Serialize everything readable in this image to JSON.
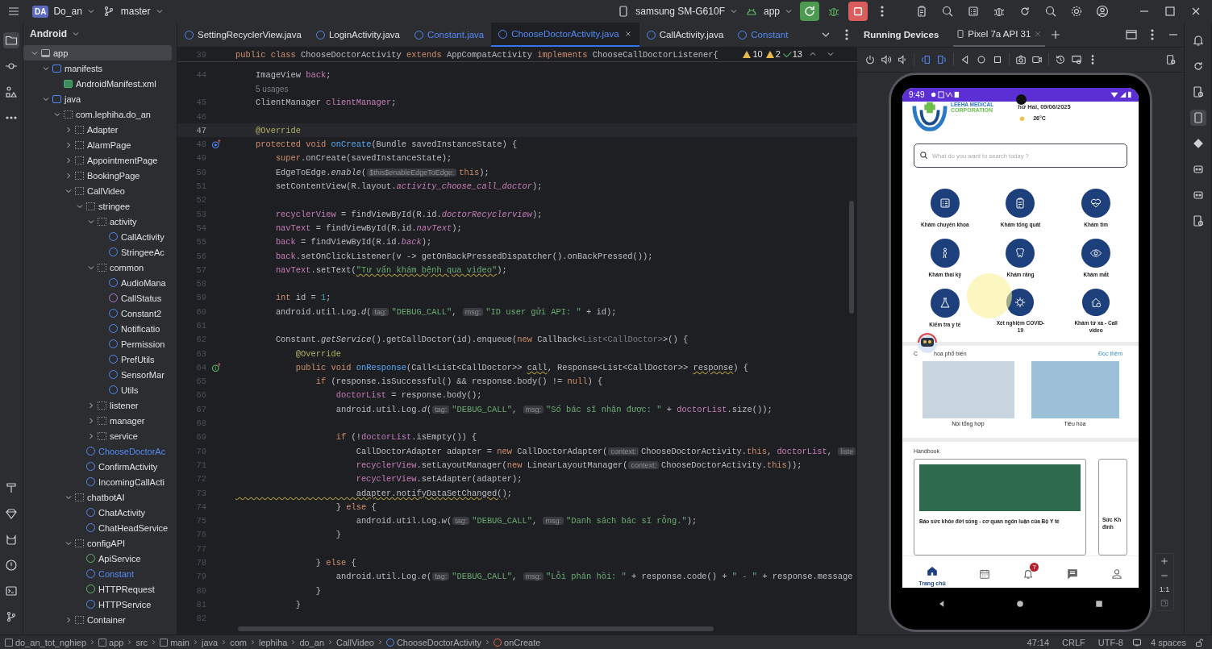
{
  "toolbar": {
    "project_badge": "DA",
    "project": "Do_an",
    "branch": "master",
    "device": "samsung SM-G610F",
    "run_config": "app"
  },
  "project_panel": {
    "view": "Android",
    "tree": [
      {
        "label": "app",
        "kind": "module",
        "expanded": true,
        "selected": true,
        "modified": false,
        "children": [
          {
            "label": "manifests",
            "kind": "folder",
            "expanded": true,
            "selected": false,
            "modified": false,
            "children": [
              {
                "label": "AndroidManifest.xml",
                "kind": "manifest",
                "selected": false,
                "modified": false
              }
            ]
          },
          {
            "label": "java",
            "kind": "folder",
            "expanded": true,
            "selected": false,
            "modified": false,
            "children": [
              {
                "label": "com.lephiha.do_an",
                "kind": "package",
                "expanded": true,
                "selected": false,
                "modified": false,
                "children": [
                  {
                    "label": "Adapter",
                    "kind": "package",
                    "expanded": false,
                    "selected": false,
                    "modified": false
                  },
                  {
                    "label": "AlarmPage",
                    "kind": "package",
                    "expanded": false,
                    "selected": false,
                    "modified": false
                  },
                  {
                    "label": "AppointmentPage",
                    "kind": "package",
                    "expanded": false,
                    "selected": false,
                    "modified": false
                  },
                  {
                    "label": "BookingPage",
                    "kind": "package",
                    "expanded": false,
                    "selected": false,
                    "modified": false
                  },
                  {
                    "label": "CallVideo",
                    "kind": "package",
                    "expanded": true,
                    "selected": false,
                    "modified": false,
                    "children": [
                      {
                        "label": "stringee",
                        "kind": "package",
                        "expanded": true,
                        "selected": false,
                        "modified": false,
                        "children": [
                          {
                            "label": "activity",
                            "kind": "package",
                            "expanded": true,
                            "selected": false,
                            "modified": false,
                            "children": [
                              {
                                "label": "CallActivity",
                                "kind": "class",
                                "selected": false,
                                "modified": false
                              },
                              {
                                "label": "StringeeAc",
                                "kind": "class",
                                "selected": false,
                                "modified": false
                              }
                            ]
                          },
                          {
                            "label": "common",
                            "kind": "package",
                            "expanded": true,
                            "selected": false,
                            "modified": false,
                            "children": [
                              {
                                "label": "AudioMana",
                                "kind": "class",
                                "selected": false,
                                "modified": false
                              },
                              {
                                "label": "CallStatus",
                                "kind": "enum",
                                "selected": false,
                                "modified": false
                              },
                              {
                                "label": "Constant2",
                                "kind": "class",
                                "selected": false,
                                "modified": false
                              },
                              {
                                "label": "Notificatio",
                                "kind": "class",
                                "selected": false,
                                "modified": false
                              },
                              {
                                "label": "Permission",
                                "kind": "class",
                                "selected": false,
                                "modified": false
                              },
                              {
                                "label": "PrefUtils",
                                "kind": "class",
                                "selected": false,
                                "modified": false
                              },
                              {
                                "label": "SensorMar",
                                "kind": "class",
                                "selected": false,
                                "modified": false
                              },
                              {
                                "label": "Utils",
                                "kind": "class",
                                "selected": false,
                                "modified": false
                              }
                            ]
                          },
                          {
                            "label": "listener",
                            "kind": "package",
                            "expanded": false,
                            "selected": false,
                            "modified": false
                          },
                          {
                            "label": "manager",
                            "kind": "package",
                            "expanded": false,
                            "selected": false,
                            "modified": false
                          },
                          {
                            "label": "service",
                            "kind": "package",
                            "expanded": false,
                            "selected": false,
                            "modified": false
                          }
                        ]
                      },
                      {
                        "label": "ChooseDoctorAc",
                        "kind": "class",
                        "selected": false,
                        "modified": true
                      },
                      {
                        "label": "ConfirmActivity",
                        "kind": "class",
                        "selected": false,
                        "modified": false
                      },
                      {
                        "label": "IncomingCallActi",
                        "kind": "class",
                        "selected": false,
                        "modified": false
                      }
                    ]
                  },
                  {
                    "label": "chatbotAI",
                    "kind": "package",
                    "expanded": true,
                    "selected": false,
                    "modified": false,
                    "children": [
                      {
                        "label": "ChatActivity",
                        "kind": "class",
                        "selected": false,
                        "modified": false
                      },
                      {
                        "label": "ChatHeadService",
                        "kind": "class",
                        "selected": false,
                        "modified": false
                      }
                    ]
                  },
                  {
                    "label": "configAPI",
                    "kind": "package",
                    "expanded": true,
                    "selected": false,
                    "modified": false,
                    "children": [
                      {
                        "label": "ApiService",
                        "kind": "interface",
                        "selected": false,
                        "modified": false
                      },
                      {
                        "label": "Constant",
                        "kind": "class",
                        "selected": false,
                        "modified": true
                      },
                      {
                        "label": "HTTPRequest",
                        "kind": "interface",
                        "selected": false,
                        "modified": false
                      },
                      {
                        "label": "HTTPService",
                        "kind": "class",
                        "selected": false,
                        "modified": false
                      }
                    ]
                  },
                  {
                    "label": "Container",
                    "kind": "package",
                    "expanded": false,
                    "selected": false,
                    "modified": false
                  }
                ]
              }
            ]
          }
        ]
      }
    ]
  },
  "editor_tabs": [
    {
      "label": "SettingRecyclerView.java",
      "selected": false,
      "modified": false
    },
    {
      "label": "LoginActivity.java",
      "selected": false,
      "modified": false
    },
    {
      "label": "Constant.java",
      "selected": false,
      "modified": true
    },
    {
      "label": "ChooseDoctorActivity.java",
      "selected": true,
      "modified": true
    },
    {
      "label": "CallActivity.java",
      "selected": false,
      "modified": false
    },
    {
      "label": "Constant",
      "selected": false,
      "modified": true
    }
  ],
  "inspections": {
    "errors": "10",
    "warnings": "2",
    "passed": "13"
  },
  "code": [
    {
      "num": "39",
      "kind": "line",
      "current": false,
      "tokens": [
        {
          "kind": "keyword",
          "text": "public class "
        },
        {
          "kind": "plain",
          "text": "ChooseDoctorActivity "
        },
        {
          "kind": "keyword",
          "text": "extends "
        },
        {
          "kind": "plain",
          "text": "AppCompatActivity "
        },
        {
          "kind": "keyword",
          "text": "implements "
        },
        {
          "kind": "plain",
          "text": "ChooseCallDoctorListener{"
        }
      ]
    },
    {
      "num": "44",
      "kind": "line",
      "current": false,
      "tokens": [
        {
          "kind": "plain",
          "text": "    ImageView "
        },
        {
          "kind": "field",
          "text": "back"
        },
        {
          "kind": "plain",
          "text": ";"
        }
      ]
    },
    {
      "kind": "usages",
      "text": "5 usages"
    },
    {
      "num": "45",
      "kind": "line",
      "current": false,
      "tokens": [
        {
          "kind": "plain",
          "text": "    ClientManager "
        },
        {
          "kind": "field",
          "text": "clientManager"
        },
        {
          "kind": "plain",
          "text": ";"
        }
      ]
    },
    {
      "num": "46",
      "kind": "line",
      "current": false
    },
    {
      "num": "47",
      "kind": "line",
      "current": true,
      "tokens": [
        {
          "kind": "annotation",
          "text": "    @Override"
        }
      ]
    },
    {
      "num": "48",
      "kind": "line",
      "current": false,
      "gutter": {
        "kind": "override"
      },
      "tokens": [
        {
          "kind": "keyword",
          "text": "    protected void "
        },
        {
          "kind": "func",
          "text": "onCreate"
        },
        {
          "kind": "plain",
          "text": "(Bundle savedInstanceState) {"
        }
      ]
    },
    {
      "num": "49",
      "kind": "line",
      "current": false,
      "tokens": [
        {
          "kind": "keyword",
          "text": "        super"
        },
        {
          "kind": "plain",
          "text": ".onCreate(savedInstanceState);"
        }
      ]
    },
    {
      "num": "50",
      "kind": "line",
      "current": false,
      "tokens": [
        {
          "kind": "plain",
          "text": "        EdgeToEdge."
        },
        {
          "kind": "italic",
          "text": "enable"
        },
        {
          "kind": "plain",
          "text": "("
        },
        {
          "kind": "hint",
          "text": "$this$enableEdgeToEdge:"
        },
        {
          "kind": "keyword",
          "text": "this"
        },
        {
          "kind": "plain",
          "text": ");"
        }
      ]
    },
    {
      "num": "51",
      "kind": "line",
      "current": false,
      "tokens": [
        {
          "kind": "plain",
          "text": "        setContentView(R.layout."
        },
        {
          "kind": "static_field",
          "text": "activity_choose_call_doctor"
        },
        {
          "kind": "plain",
          "text": ");"
        }
      ]
    },
    {
      "num": "52",
      "kind": "line",
      "current": false
    },
    {
      "num": "53",
      "kind": "line",
      "current": false,
      "tokens": [
        {
          "kind": "field",
          "text": "        recyclerView"
        },
        {
          "kind": "plain",
          "text": " = findViewById(R.id."
        },
        {
          "kind": "static_field",
          "text": "doctorRecyclerview"
        },
        {
          "kind": "plain",
          "text": ");"
        }
      ]
    },
    {
      "num": "54",
      "kind": "line",
      "current": false,
      "tokens": [
        {
          "kind": "field",
          "text": "        navText"
        },
        {
          "kind": "plain",
          "text": " = findViewById(R.id."
        },
        {
          "kind": "static_field",
          "text": "navText"
        },
        {
          "kind": "plain",
          "text": ");"
        }
      ]
    },
    {
      "num": "55",
      "kind": "line",
      "current": false,
      "tokens": [
        {
          "kind": "field",
          "text": "        back"
        },
        {
          "kind": "plain",
          "text": " = findViewById(R.id."
        },
        {
          "kind": "static_field",
          "text": "back"
        },
        {
          "kind": "plain",
          "text": ");"
        }
      ]
    },
    {
      "num": "56",
      "kind": "line",
      "current": false,
      "tokens": [
        {
          "kind": "field",
          "text": "        back"
        },
        {
          "kind": "plain",
          "text": ".setOnClickListener(v -> getOnBackPressedDispatcher().onBackPressed());"
        }
      ]
    },
    {
      "num": "57",
      "kind": "line",
      "current": false,
      "tokens": [
        {
          "kind": "field",
          "text": "        navText"
        },
        {
          "kind": "plain",
          "text": ".setText("
        },
        {
          "kind": "string_typo",
          "text": "\"Tư vấn khám bệnh qua video\""
        },
        {
          "kind": "plain",
          "text": ");"
        }
      ]
    },
    {
      "num": "58",
      "kind": "line",
      "current": false
    },
    {
      "num": "59",
      "kind": "line",
      "current": false,
      "tokens": [
        {
          "kind": "keyword",
          "text": "        int "
        },
        {
          "kind": "plain",
          "text": "id = "
        },
        {
          "kind": "number",
          "text": "1"
        },
        {
          "kind": "plain",
          "text": ";"
        }
      ]
    },
    {
      "num": "60",
      "kind": "line",
      "current": false,
      "tokens": [
        {
          "kind": "plain",
          "text": "        android.util.Log."
        },
        {
          "kind": "italic",
          "text": "d"
        },
        {
          "kind": "plain",
          "text": "("
        },
        {
          "kind": "hint",
          "text": "tag:"
        },
        {
          "kind": "string",
          "text": "\"DEBUG_CALL\""
        },
        {
          "kind": "plain",
          "text": ", "
        },
        {
          "kind": "hint",
          "text": "msg:"
        },
        {
          "kind": "string",
          "text": "\"ID user gửi API: \""
        },
        {
          "kind": "plain",
          "text": " + id);"
        }
      ]
    },
    {
      "num": "61",
      "kind": "line",
      "current": false
    },
    {
      "num": "62",
      "kind": "line",
      "current": false,
      "tokens": [
        {
          "kind": "plain",
          "text": "        Constant."
        },
        {
          "kind": "italic",
          "text": "getService"
        },
        {
          "kind": "plain",
          "text": "().getCallDoctor(id).enqueue("
        },
        {
          "kind": "keyword",
          "text": "new "
        },
        {
          "kind": "plain",
          "text": "Callback<"
        },
        {
          "kind": "type_arg",
          "text": "List<CallDoctor>"
        },
        {
          "kind": "plain",
          "text": ">() {"
        }
      ]
    },
    {
      "num": "63",
      "kind": "line",
      "current": false,
      "tokens": [
        {
          "kind": "annotation",
          "text": "            @Override"
        }
      ]
    },
    {
      "num": "64",
      "kind": "line",
      "current": false,
      "gutter": {
        "kind": "implement"
      },
      "tokens": [
        {
          "kind": "keyword",
          "text": "            public void "
        },
        {
          "kind": "func",
          "text": "onResponse"
        },
        {
          "kind": "plain",
          "text": "(Call<List<CallDoctor>> "
        },
        {
          "kind": "typo",
          "text": "call"
        },
        {
          "kind": "plain",
          "text": ", Response<List<CallDoctor>> "
        },
        {
          "kind": "typo",
          "text": "response"
        },
        {
          "kind": "plain",
          "text": ") {"
        }
      ]
    },
    {
      "num": "65",
      "kind": "line",
      "current": false,
      "tokens": [
        {
          "kind": "keyword",
          "text": "                if "
        },
        {
          "kind": "plain",
          "text": "(response.isSuccessful() && response.body() != "
        },
        {
          "kind": "keyword",
          "text": "null"
        },
        {
          "kind": "plain",
          "text": ") {"
        }
      ]
    },
    {
      "num": "66",
      "kind": "line",
      "current": false,
      "tokens": [
        {
          "kind": "field",
          "text": "                    doctorList"
        },
        {
          "kind": "plain",
          "text": " = response.body();"
        }
      ]
    },
    {
      "num": "67",
      "kind": "line",
      "current": false,
      "tokens": [
        {
          "kind": "plain",
          "text": "                    android.util.Log."
        },
        {
          "kind": "italic",
          "text": "d"
        },
        {
          "kind": "plain",
          "text": "("
        },
        {
          "kind": "hint",
          "text": "tag:"
        },
        {
          "kind": "string",
          "text": "\"DEBUG_CALL\""
        },
        {
          "kind": "plain",
          "text": ", "
        },
        {
          "kind": "hint",
          "text": "msg:"
        },
        {
          "kind": "string",
          "text": "\"Số bác sĩ nhận được: \""
        },
        {
          "kind": "plain",
          "text": " + "
        },
        {
          "kind": "field",
          "text": "doctorList"
        },
        {
          "kind": "plain",
          "text": ".size());"
        }
      ]
    },
    {
      "num": "68",
      "kind": "line",
      "current": false
    },
    {
      "num": "69",
      "kind": "line",
      "current": false,
      "tokens": [
        {
          "kind": "keyword",
          "text": "                    if "
        },
        {
          "kind": "plain",
          "text": "(!"
        },
        {
          "kind": "field",
          "text": "doctorList"
        },
        {
          "kind": "plain",
          "text": ".isEmpty()) {"
        }
      ]
    },
    {
      "num": "70",
      "kind": "line",
      "current": false,
      "tokens": [
        {
          "kind": "plain",
          "text": "                        CallDoctorAdapter adapter = "
        },
        {
          "kind": "keyword",
          "text": "new "
        },
        {
          "kind": "plain",
          "text": "CallDoctorAdapter("
        },
        {
          "kind": "hint",
          "text": "context:"
        },
        {
          "kind": "plain",
          "text": "ChooseDoctorActivity."
        },
        {
          "kind": "keyword",
          "text": "this"
        },
        {
          "kind": "plain",
          "text": ", "
        },
        {
          "kind": "field",
          "text": "doctorList"
        },
        {
          "kind": "plain",
          "text": ", "
        },
        {
          "kind": "hint",
          "text": "liste"
        }
      ]
    },
    {
      "num": "71",
      "kind": "line",
      "current": false,
      "tokens": [
        {
          "kind": "field",
          "text": "                        recyclerView"
        },
        {
          "kind": "plain",
          "text": ".setLayoutManager("
        },
        {
          "kind": "keyword",
          "text": "new "
        },
        {
          "kind": "plain",
          "text": "LinearLayoutManager("
        },
        {
          "kind": "hint",
          "text": "context:"
        },
        {
          "kind": "plain",
          "text": "ChooseDoctorActivity."
        },
        {
          "kind": "keyword",
          "text": "this"
        },
        {
          "kind": "plain",
          "text": "));"
        }
      ]
    },
    {
      "num": "72",
      "kind": "line",
      "current": false,
      "tokens": [
        {
          "kind": "field",
          "text": "                        recyclerView"
        },
        {
          "kind": "plain",
          "text": ".setAdapter(adapter);"
        }
      ]
    },
    {
      "num": "73",
      "kind": "line",
      "current": false,
      "tokens": [
        {
          "kind": "typo",
          "text": "                        adapter.notifyDataSetChanged()"
        },
        {
          "kind": "plain",
          "text": ";"
        }
      ]
    },
    {
      "num": "74",
      "kind": "line",
      "current": false,
      "tokens": [
        {
          "kind": "plain",
          "text": "                    } "
        },
        {
          "kind": "keyword",
          "text": "else"
        },
        {
          "kind": "plain",
          "text": " {"
        }
      ]
    },
    {
      "num": "75",
      "kind": "line",
      "current": false,
      "tokens": [
        {
          "kind": "plain",
          "text": "                        android.util.Log."
        },
        {
          "kind": "italic",
          "text": "w"
        },
        {
          "kind": "plain",
          "text": "("
        },
        {
          "kind": "hint",
          "text": "tag:"
        },
        {
          "kind": "string",
          "text": "\"DEBUG_CALL\""
        },
        {
          "kind": "plain",
          "text": ", "
        },
        {
          "kind": "hint",
          "text": "msg:"
        },
        {
          "kind": "string",
          "text": "\"Danh sách bác sĩ rỗng.\""
        },
        {
          "kind": "plain",
          "text": ");"
        }
      ]
    },
    {
      "num": "76",
      "kind": "line",
      "current": false,
      "tokens": [
        {
          "kind": "plain",
          "text": "                    }"
        }
      ]
    },
    {
      "num": "77",
      "kind": "line",
      "current": false
    },
    {
      "num": "78",
      "kind": "line",
      "current": false,
      "tokens": [
        {
          "kind": "plain",
          "text": "                } "
        },
        {
          "kind": "keyword",
          "text": "else"
        },
        {
          "kind": "plain",
          "text": " {"
        }
      ]
    },
    {
      "num": "79",
      "kind": "line",
      "current": false,
      "tokens": [
        {
          "kind": "plain",
          "text": "                    android.util.Log."
        },
        {
          "kind": "italic",
          "text": "e"
        },
        {
          "kind": "plain",
          "text": "("
        },
        {
          "kind": "hint",
          "text": "tag:"
        },
        {
          "kind": "string",
          "text": "\"DEBUG_CALL\""
        },
        {
          "kind": "plain",
          "text": ", "
        },
        {
          "kind": "hint",
          "text": "msg:"
        },
        {
          "kind": "string",
          "text": "\"Lỗi phản hồi: \""
        },
        {
          "kind": "plain",
          "text": " + response.code() + "
        },
        {
          "kind": "string",
          "text": "\" - \""
        },
        {
          "kind": "plain",
          "text": " + response.message"
        }
      ]
    },
    {
      "num": "80",
      "kind": "line",
      "current": false,
      "tokens": [
        {
          "kind": "plain",
          "text": "                }"
        }
      ]
    },
    {
      "num": "81",
      "kind": "line",
      "current": false,
      "tokens": [
        {
          "kind": "plain",
          "text": "            }"
        }
      ]
    },
    {
      "num": "82",
      "kind": "line",
      "current": false
    }
  ],
  "breadcrumb": [
    {
      "label": "do_an_tot_nghiep",
      "kind": "module"
    },
    {
      "label": "app",
      "kind": "module"
    },
    {
      "label": "src",
      "kind": "plain"
    },
    {
      "label": "main",
      "kind": "module"
    },
    {
      "label": "java",
      "kind": "plain"
    },
    {
      "label": "com",
      "kind": "plain"
    },
    {
      "label": "lephiha",
      "kind": "plain"
    },
    {
      "label": "do_an",
      "kind": "plain"
    },
    {
      "label": "CallVideo",
      "kind": "plain"
    },
    {
      "label": "ChooseDoctorActivity",
      "kind": "class"
    },
    {
      "label": "onCreate",
      "kind": "method"
    }
  ],
  "status": {
    "position": "47:14",
    "line_separator": "CRLF",
    "encoding": "UTF-8",
    "indent": "4 spaces"
  },
  "devices_panel": {
    "title": "Running Devices",
    "tab": "Pixel 7a API 31",
    "zoom_label": "1:1",
    "phone": {
      "time": "9:49",
      "brand": "LEEHA MEDICAL",
      "brand_sub": "CORPORATION",
      "date": "hứ Hai, 09/06/2025",
      "temperature": "26°C",
      "search_placeholder": "What do you want to search today ?",
      "services": [
        {
          "label": "Khám chuyên khoa",
          "kind": "specialty"
        },
        {
          "label": "Khám tổng quát",
          "kind": "general"
        },
        {
          "label": "Khám tim",
          "kind": "heart"
        },
        {
          "label": "Khám thai kỳ",
          "kind": "pregnancy"
        },
        {
          "label": "Khám răng",
          "kind": "tooth"
        },
        {
          "label": "Khám mắt",
          "kind": "eye"
        },
        {
          "label": "Kiểm tra y tế",
          "kind": "test"
        },
        {
          "label": "Xét nghiệm COVID-19",
          "kind": "covid"
        },
        {
          "label": "Khám từ xa - Call video",
          "kind": "remote"
        }
      ],
      "popular": {
        "title_start": "C",
        "title_end": "hoa phổ biến",
        "more": "Đọc thêm",
        "items": [
          "Nội tổng hợp",
          "Tiêu hóa"
        ]
      },
      "handbook": {
        "title": "Handbook",
        "cards": [
          "Báo sức khỏe đời sống - cơ quan ngôn luận của Bộ Y tế",
          "Sức Kh đình"
        ]
      },
      "nav": [
        {
          "kind": "home",
          "label": "Trang chủ",
          "selected": true
        },
        {
          "kind": "calendar",
          "selected": false
        },
        {
          "kind": "bell",
          "badge": "7",
          "selected": false
        },
        {
          "kind": "chat",
          "selected": false
        },
        {
          "kind": "profile",
          "selected": false
        }
      ]
    }
  }
}
